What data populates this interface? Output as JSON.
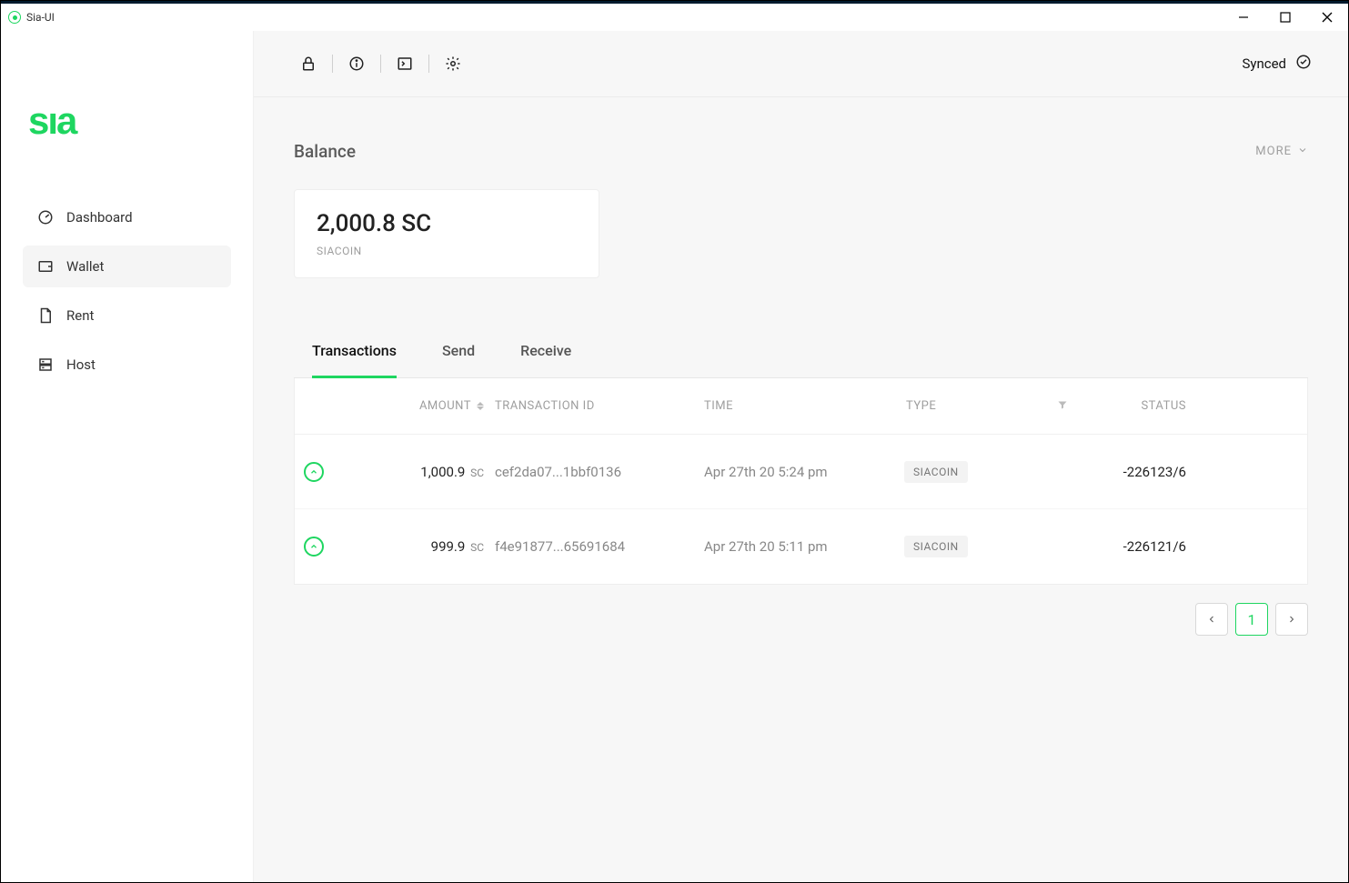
{
  "window": {
    "title": "Sia-UI"
  },
  "sidebar": {
    "items": [
      {
        "label": "Dashboard"
      },
      {
        "label": "Wallet"
      },
      {
        "label": "Rent"
      },
      {
        "label": "Host"
      }
    ]
  },
  "topbar": {
    "sync_status": "Synced"
  },
  "balance": {
    "label": "Balance",
    "amount": "2,000.8 SC",
    "unit_label": "SIACOIN",
    "more_label": "MORE"
  },
  "tabs": [
    {
      "label": "Transactions"
    },
    {
      "label": "Send"
    },
    {
      "label": "Receive"
    }
  ],
  "table": {
    "headers": {
      "amount": "AMOUNT",
      "txid": "TRANSACTION ID",
      "time": "TIME",
      "type": "TYPE",
      "status": "STATUS"
    },
    "rows": [
      {
        "amount": "1,000.9",
        "unit": "SC",
        "txid": "cef2da07...1bbf0136",
        "time": "Apr 27th 20 5:24 pm",
        "type": "SIACOIN",
        "status": "-226123/6"
      },
      {
        "amount": "999.9",
        "unit": "SC",
        "txid": "f4e91877...65691684",
        "time": "Apr 27th 20 5:11 pm",
        "type": "SIACOIN",
        "status": "-226121/6"
      }
    ]
  },
  "pagination": {
    "page": "1"
  }
}
